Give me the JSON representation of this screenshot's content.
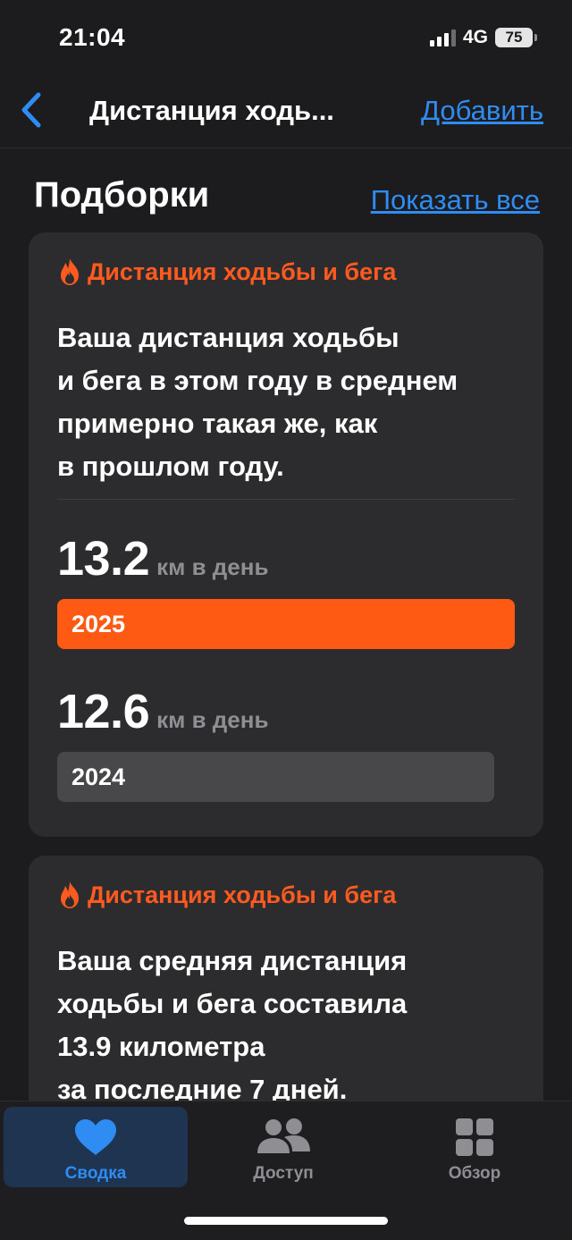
{
  "status_bar": {
    "time": "21:04",
    "network": "4G",
    "battery": "75"
  },
  "nav": {
    "title": "Дистанция ходь...",
    "add_label": "Добавить"
  },
  "section": {
    "title": "Подборки",
    "show_all": "Показать все"
  },
  "cards": [
    {
      "category": "Дистанция ходьбы и бега",
      "text_lines": [
        "Ваша дистанция ходьбы",
        "и бега в этом году в среднем",
        "примерно такая же, как",
        "в прошлом году."
      ],
      "metrics": [
        {
          "value": "13.2",
          "unit": "км в день",
          "year": "2025",
          "km_per_day": 13.2
        },
        {
          "value": "12.6",
          "unit": "км в день",
          "year": "2024",
          "km_per_day": 12.6
        }
      ]
    },
    {
      "category": "Дистанция ходьбы и бега",
      "text_lines": [
        "Ваша средняя дистанция",
        "ходьбы и бега составила",
        "13.9 километра",
        "за последние 7 дней."
      ]
    }
  ],
  "tabs": [
    {
      "label": "Сводка",
      "icon": "heart-icon",
      "selected": true
    },
    {
      "label": "Доступ",
      "icon": "people-icon",
      "selected": false
    },
    {
      "label": "Обзор",
      "icon": "grid-icon",
      "selected": false
    }
  ],
  "colors": {
    "accent_orange": "#ff5a1f",
    "link_blue": "#2f8cf3",
    "background": "#1c1c1e",
    "card": "#2c2c2e"
  }
}
